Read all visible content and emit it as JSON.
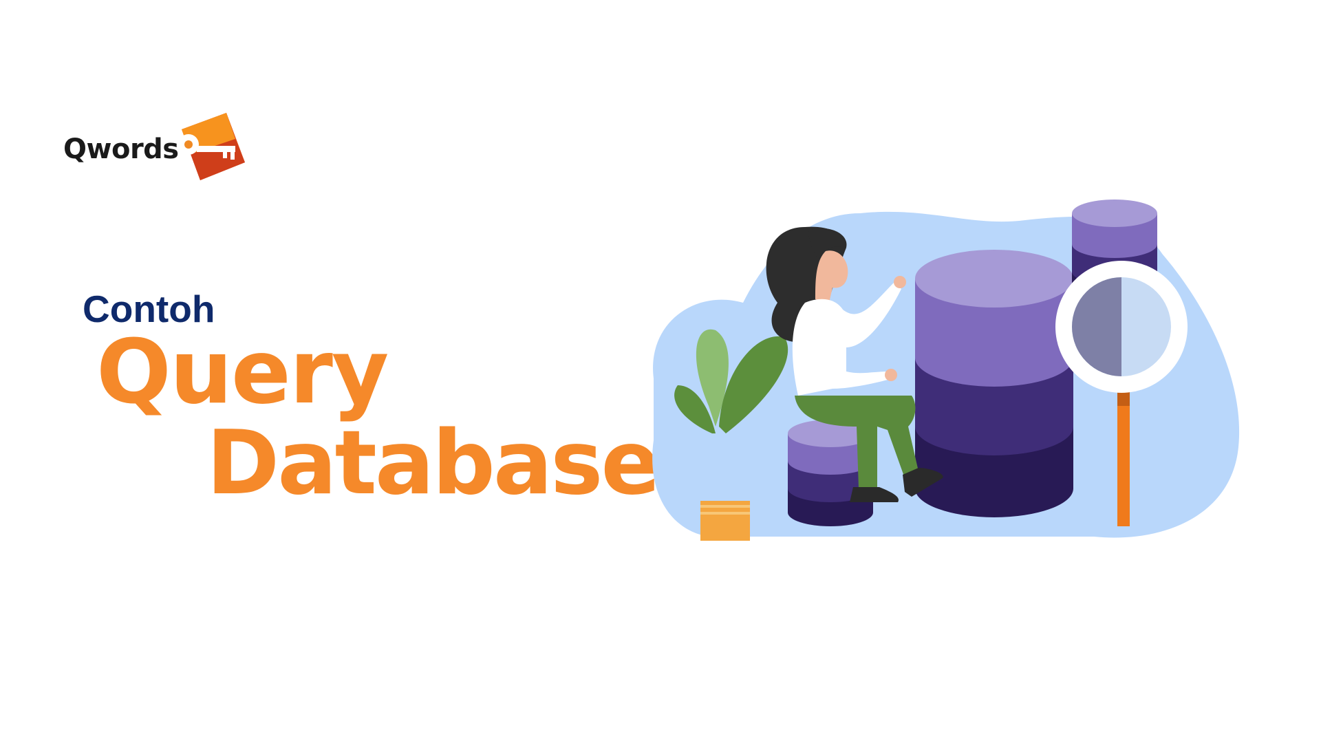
{
  "logo": {
    "brand_name": "Qwords",
    "icon": "key-icon",
    "colors": {
      "mark_light": "#f7931e",
      "mark_dark": "#d7401c"
    }
  },
  "heading": {
    "subtitle": "Contoh",
    "title_line_1": "Query",
    "title_line_2": "Database"
  },
  "illustration": {
    "icon_names": [
      "woman-figure",
      "database-icon",
      "magnifier-icon",
      "plant-icon"
    ]
  },
  "colors": {
    "subtitle": "#0f2a6b",
    "title": "#f5892a",
    "blob": "#b9d7fb",
    "db_light": "#a69ad6",
    "db_mid": "#7f6bbd",
    "db_dark": "#3f2d78",
    "db_darkest": "#281a55",
    "accent": "#f07a1b"
  }
}
